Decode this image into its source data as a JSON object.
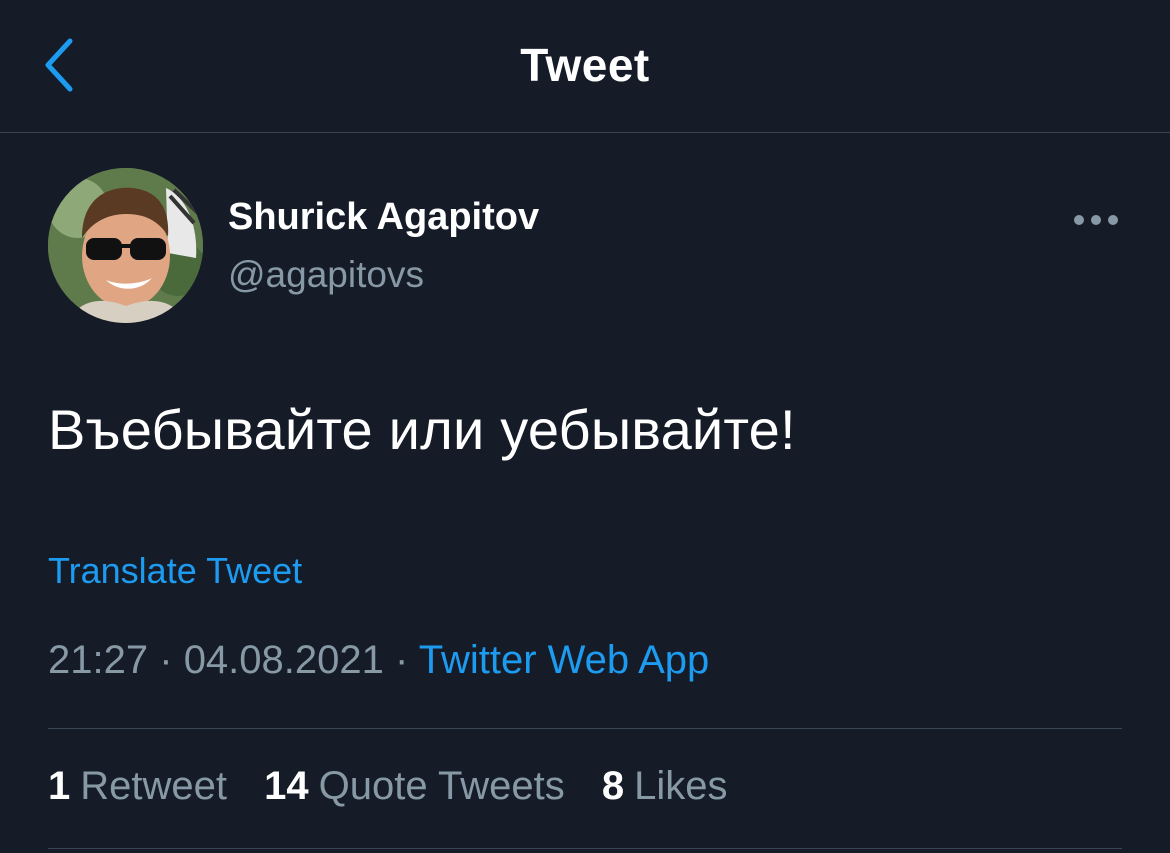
{
  "header": {
    "title": "Tweet",
    "back_icon": "chevron-left-icon"
  },
  "author": {
    "name": "Shurick Agapitov",
    "handle": "@agapitovs"
  },
  "tweet": {
    "text": "Въебывайте или уебывайте!",
    "translate_label": "Translate Tweet",
    "time": "21:27",
    "date": "04.08.2021",
    "separator": "·",
    "source": "Twitter Web App"
  },
  "stats": {
    "retweets_count": "1",
    "retweets_label": "Retweet",
    "quotes_count": "14",
    "quotes_label": "Quote Tweets",
    "likes_count": "8",
    "likes_label": "Likes"
  },
  "colors": {
    "background": "#151c28",
    "accent": "#1d9bf0",
    "secondary_text": "#8899a6",
    "divider": "#3a4656"
  }
}
